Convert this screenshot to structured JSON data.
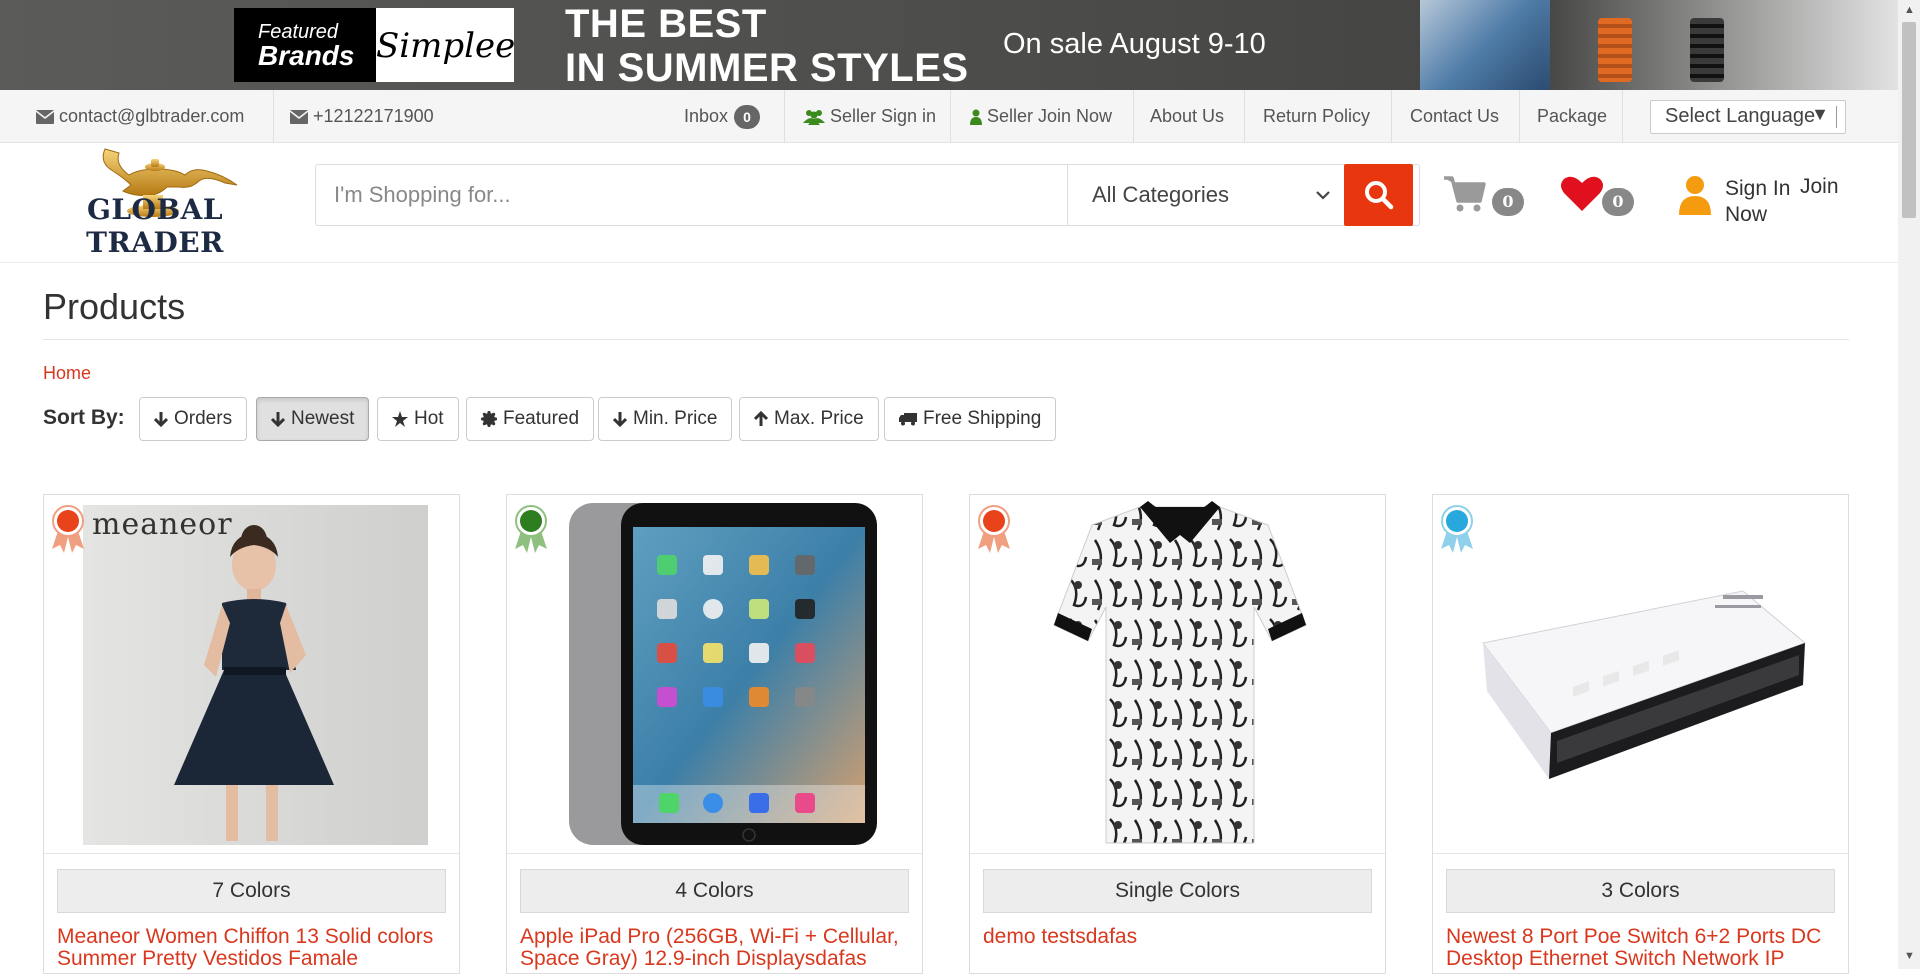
{
  "banner": {
    "featured": "Featured",
    "brands": "Brands",
    "simplee": "Simplee",
    "headline1": "THE BEST",
    "headline2": "IN SUMMER STYLES",
    "sale": "On sale August 9-10"
  },
  "topbar": {
    "email": "contact@glbtrader.com",
    "phone": "+12122171900",
    "inbox_label": "Inbox",
    "inbox_count": "0",
    "seller_signin": "Seller Sign in",
    "seller_join": "Seller Join Now",
    "about": "About Us",
    "return_policy": "Return Policy",
    "contact": "Contact Us",
    "package": "Package",
    "language": "Select Language"
  },
  "header": {
    "logo_text": "GLOBAL TRADER",
    "search_placeholder": "I'm Shopping for...",
    "category": "All Categories",
    "cart_count": "0",
    "wishlist_count": "0",
    "sign_in": "Sign In",
    "join_now_1": "Join",
    "join_now_2": "Now"
  },
  "page": {
    "title": "Products",
    "breadcrumb": "Home",
    "sort_label": "Sort By:",
    "sort_buttons": [
      {
        "label": "Orders",
        "icon": "arrow-down-icon"
      },
      {
        "label": "Newest",
        "icon": "arrow-down-icon",
        "active": true
      },
      {
        "label": "Hot",
        "icon": "star-icon"
      },
      {
        "label": "Featured",
        "icon": "certificate-icon"
      },
      {
        "label": "Min. Price",
        "icon": "arrow-down-icon"
      },
      {
        "label": "Max. Price",
        "icon": "arrow-up-icon"
      },
      {
        "label": "Free Shipping",
        "icon": "truck-icon"
      }
    ]
  },
  "products": [
    {
      "colors": "7 Colors",
      "name": "Meaneor Women Chiffon 13 Solid colors Summer Pretty Vestidos Famale",
      "medal": "#e8431a",
      "brand_mark": "meaneor"
    },
    {
      "colors": "4 Colors",
      "name": "Apple iPad Pro (256GB, Wi-Fi + Cellular, Space Gray) 12.9-inch Displaysdafas",
      "medal": "#2e7d1e"
    },
    {
      "colors": "Single Colors",
      "name": "demo testsdafas",
      "medal": "#e8431a"
    },
    {
      "colors": "3 Colors",
      "name": "Newest 8 Port Poe Switch 6+2 Ports DC Desktop Ethernet Switch Network IP",
      "medal": "#29a8dd"
    }
  ],
  "colors": {
    "accent": "#d9381e",
    "search_button": "#e8360f",
    "seller_icon": "#3a8a1e",
    "heart": "#e0101e",
    "user_icon": "#f59b10"
  }
}
